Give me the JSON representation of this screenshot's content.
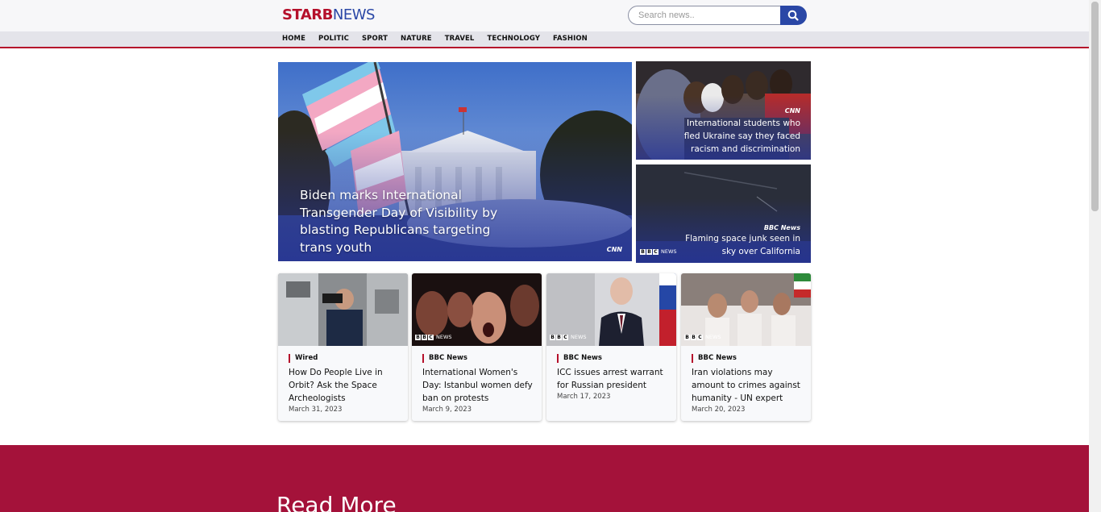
{
  "header": {
    "logo_part1": "STARB",
    "logo_part2": "NEWS",
    "search_placeholder": "Search news.."
  },
  "nav": [
    "HOME",
    "POLITIC",
    "SPORT",
    "NATURE",
    "TRAVEL",
    "TECHNOLOGY",
    "FASHION"
  ],
  "hero": {
    "title": "Biden marks International Transgender Day of Visibility by blasting Republicans targeting trans youth",
    "source": "CNN"
  },
  "side_stories": [
    {
      "source": "CNN",
      "title": "International students who fled Ukraine say they faced racism and discrimination"
    },
    {
      "source": "BBC News",
      "title": "Flaming space junk seen in sky over California"
    }
  ],
  "cards": [
    {
      "source": "Wired",
      "title": "How Do People Live in Orbit? Ask the Space Archeologists",
      "date": "March 31, 2023"
    },
    {
      "source": "BBC News",
      "title": "International Women's Day: Istanbul women defy ban on protests",
      "date": "March 9, 2023"
    },
    {
      "source": "BBC News",
      "title": "ICC issues arrest warrant for Russian president",
      "date": "March 17, 2023"
    },
    {
      "source": "BBC News",
      "title": "Iran violations may amount to crimes against humanity - UN expert",
      "date": "March 20, 2023"
    }
  ],
  "read_more": {
    "heading": "Read More"
  },
  "bbc_watermark": "NEWS",
  "colors": {
    "brand_red": "#b5102b",
    "brand_blue": "#2a47a6",
    "section_red": "#a4123a"
  }
}
